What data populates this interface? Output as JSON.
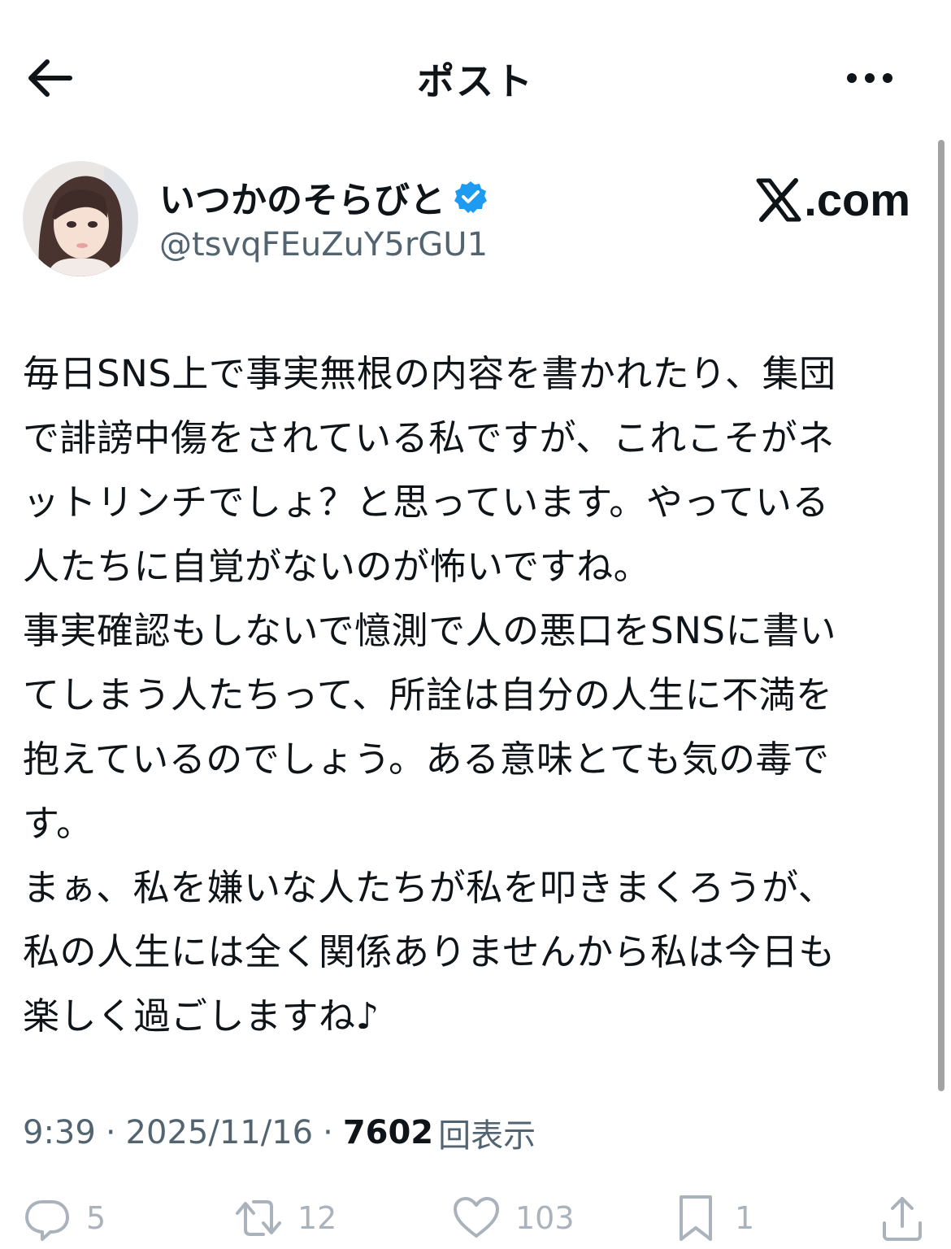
{
  "header": {
    "title": "ポスト"
  },
  "author": {
    "display_name": "いつかのそらびと",
    "handle": "@tsvqFEuZuY5rGU1",
    "verified": true
  },
  "watermark": {
    "text": ".com"
  },
  "tweet": {
    "lines": [
      "毎日SNS上で事実無根の内容を書かれたり、集団",
      "で誹謗中傷をされている私ですが、これこそがネ",
      "ットリンチでしょ？と思っています。やっている",
      "人たちに自覚がないのが怖いですね。",
      "事実確認もしないで憶測で人の悪口をSNSに書い",
      "てしまう人たちって、所詮は自分の人生に不満を",
      "抱えているのでしょう。ある意味とても気の毒で",
      "す。",
      "まぁ、私を嫌いな人たちが私を叩きまくろうが、",
      "私の人生には全く関係ありませんから私は今日も",
      "楽しく過ごしますね♪"
    ]
  },
  "meta": {
    "time": "9:39",
    "separator": "·",
    "date": "2025/11/16",
    "views_count": "7602",
    "views_label": "回表示"
  },
  "actions": {
    "replies": "5",
    "reposts": "12",
    "likes": "103",
    "bookmarks": "1"
  },
  "colors": {
    "text": "#0f1419",
    "secondary": "#536471",
    "verified_blue": "#1d9bf0",
    "action_gray": "#aab3bb"
  },
  "icons": {
    "back": "arrow-left-icon",
    "more": "more-horizontal-icon",
    "verified": "verified-badge-icon",
    "reply": "reply-icon",
    "repost": "repost-icon",
    "like": "heart-icon",
    "bookmark": "bookmark-icon",
    "share": "share-icon"
  }
}
